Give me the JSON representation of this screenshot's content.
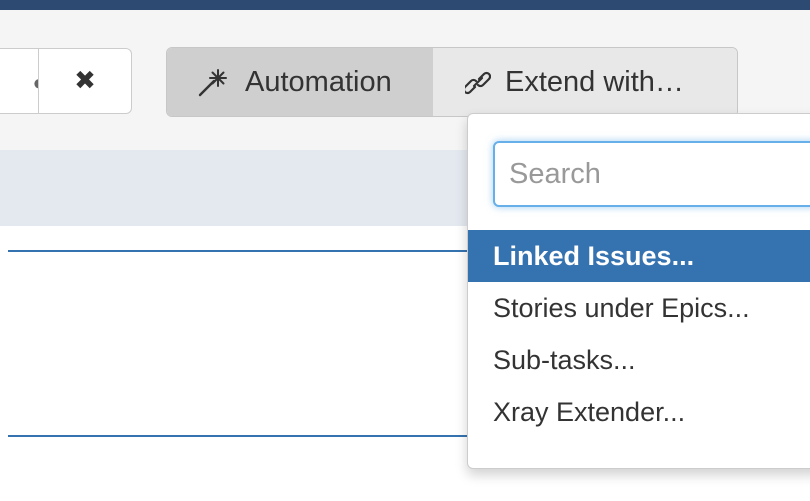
{
  "toolbar": {
    "close_button": {
      "icon": "close-icon"
    },
    "automation_button": {
      "label": "Automation",
      "icon": "magic-wand-icon"
    },
    "extend_button": {
      "label": "Extend with…",
      "icon": "link-icon"
    }
  },
  "dropdown": {
    "search": {
      "placeholder": "Search",
      "value": ""
    },
    "items": [
      {
        "label": "Linked Issues...",
        "active": true
      },
      {
        "label": "Stories under Epics...",
        "active": false
      },
      {
        "label": "Sub-tasks...",
        "active": false
      },
      {
        "label": "Xray Extender...",
        "active": false
      }
    ]
  },
  "colors": {
    "header": "#2c4a72",
    "accent": "#3572b0",
    "focus": "#66afe9",
    "band": "#e4e9f0"
  }
}
